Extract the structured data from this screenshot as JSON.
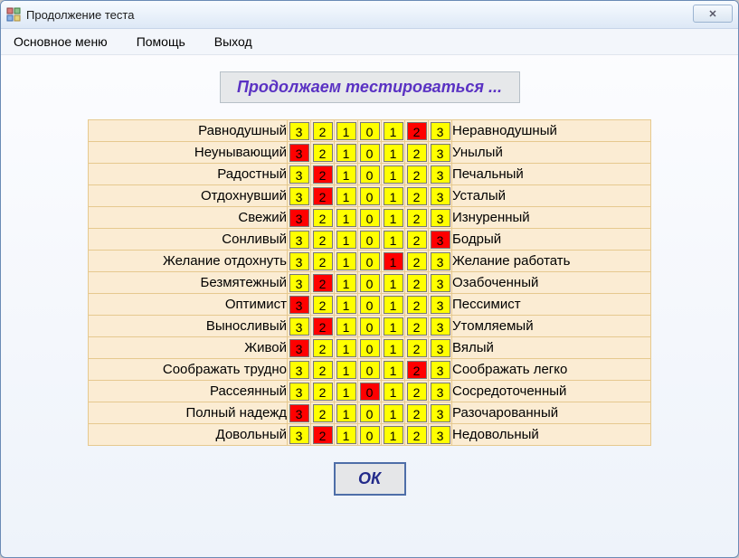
{
  "window": {
    "title": "Продолжение теста"
  },
  "menu": {
    "main": "Основное меню",
    "help": "Помощь",
    "exit": "Выход"
  },
  "heading": "Продолжаем тестироваться ...",
  "scale_values": [
    "3",
    "2",
    "1",
    "0",
    "1",
    "2",
    "3"
  ],
  "rows": [
    {
      "left": "Равнодушный",
      "selected": 5,
      "right": "Неравнодушный"
    },
    {
      "left": "Неунывающий",
      "selected": 0,
      "right": "Унылый"
    },
    {
      "left": "Радостный",
      "selected": 1,
      "right": "Печальный"
    },
    {
      "left": "Отдохнувший",
      "selected": 1,
      "right": "Усталый"
    },
    {
      "left": "Свежий",
      "selected": 0,
      "right": "Изнуренный"
    },
    {
      "left": "Сонливый",
      "selected": 6,
      "right": "Бодрый"
    },
    {
      "left": "Желание отдохнуть",
      "selected": 4,
      "right": "Желание работать"
    },
    {
      "left": "Безмятежный",
      "selected": 1,
      "right": "Озабоченный"
    },
    {
      "left": "Оптимист",
      "selected": 0,
      "right": "Пессимист"
    },
    {
      "left": "Выносливый",
      "selected": 1,
      "right": "Утомляемый"
    },
    {
      "left": "Живой",
      "selected": 0,
      "right": "Вялый"
    },
    {
      "left": "Соображать трудно",
      "selected": 5,
      "right": "Соображать легко"
    },
    {
      "left": "Рассеянный",
      "selected": 3,
      "right": "Сосредоточенный"
    },
    {
      "left": "Полный надежд",
      "selected": 0,
      "right": "Разочарованный"
    },
    {
      "left": "Довольный",
      "selected": 1,
      "right": "Недовольный"
    }
  ],
  "ok_label": "ОК"
}
